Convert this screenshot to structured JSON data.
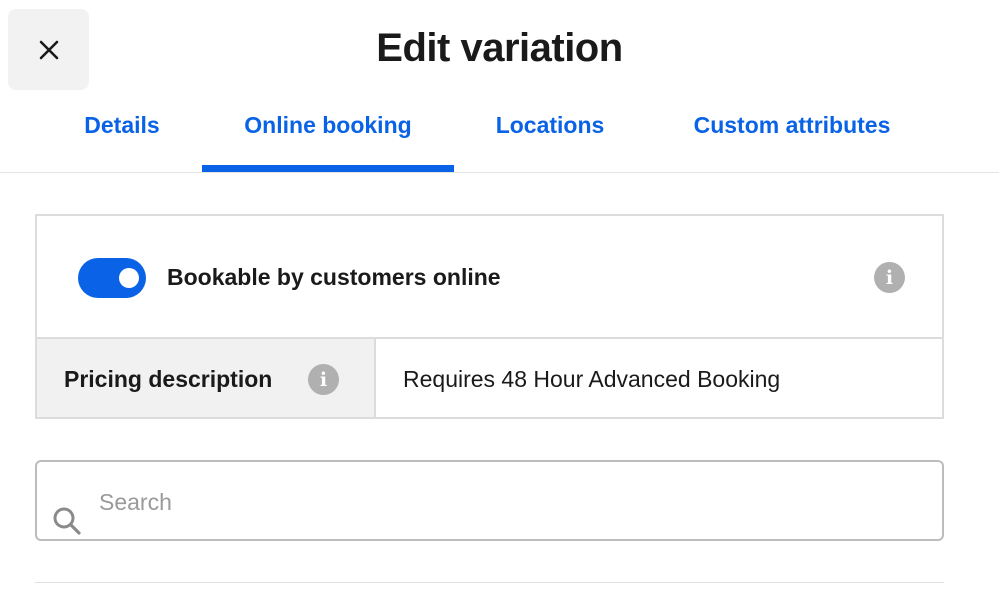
{
  "header": {
    "title": "Edit variation",
    "close_icon": "close-icon"
  },
  "tabs": [
    {
      "label": "Details",
      "active": false
    },
    {
      "label": "Online booking",
      "active": true
    },
    {
      "label": "Locations",
      "active": false
    },
    {
      "label": "Custom attributes",
      "active": false
    }
  ],
  "booking": {
    "toggle_label": "Bookable by customers online",
    "toggle_on": true,
    "info_icon": "info-icon"
  },
  "pricing": {
    "label": "Pricing description",
    "value": "Requires 48 Hour Advanced Booking",
    "info_icon": "info-icon"
  },
  "search": {
    "placeholder": "Search",
    "value": "",
    "icon": "search-icon"
  },
  "colors": {
    "accent": "#0a63e6",
    "info_icon": "#b0b0b0",
    "label_cell_bg": "#f1f1f1"
  }
}
